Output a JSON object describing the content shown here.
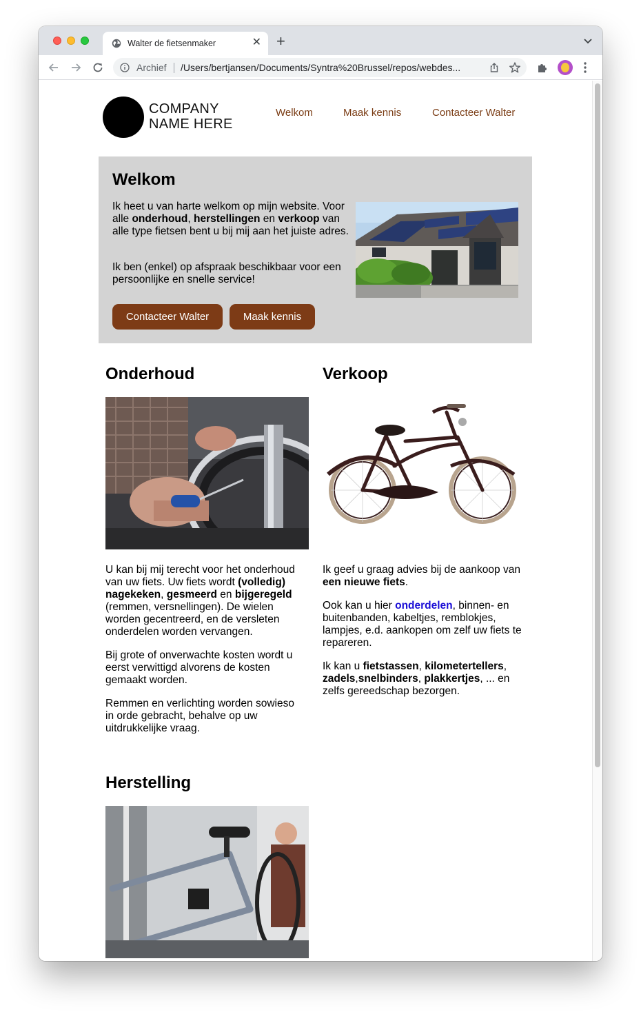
{
  "browser": {
    "tab_title": "Walter de fietsenmaker",
    "omnibox_label": "Archief",
    "url": "/Users/bertjansen/Documents/Syntra%20Brussel/repos/webdes..."
  },
  "site": {
    "logo_line1": "COMPANY",
    "logo_line2": "NAME HERE",
    "nav": [
      "Welkom",
      "Maak kennis",
      "Contacteer Walter"
    ]
  },
  "hero": {
    "heading": "Welkom",
    "p1": {
      "a": "Ik heet u van harte welkom op mijn website. Voor alle ",
      "b1": "onderhoud",
      "c": ", ",
      "b2": "herstellingen",
      "d": " en ",
      "b3": "verkoop",
      "e": " van alle type fietsen bent u bij mij aan het juiste adres."
    },
    "p2": "Ik ben (enkel) op afspraak beschikbaar voor een persoonlijke en snelle service!",
    "button_contact": "Contacteer Walter",
    "button_meet": "Maak kennis"
  },
  "onderhoud": {
    "heading": "Onderhoud",
    "p1": {
      "a": "U kan bij mij terecht voor het onderhoud van uw fiets. Uw fiets wordt ",
      "b1": "(volledig) nagekeken",
      "c": ", ",
      "b2": "gesmeerd",
      "d": " en ",
      "b3": "bijgeregeld",
      "e": " (remmen, versnellingen). De wielen worden gecentreerd, en de versleten onderdelen worden vervangen."
    },
    "p2": "Bij grote of onverwachte kosten wordt u eerst verwittigd alvorens de kosten gemaakt worden.",
    "p3": "Remmen en verlichting worden sowieso in orde gebracht, behalve op uw uitdrukkelijke vraag."
  },
  "verkoop": {
    "heading": "Verkoop",
    "p1": {
      "a": "Ik geef u graag advies bij de aankoop van ",
      "b1": "een nieuwe fiets",
      "c": "."
    },
    "p2": {
      "a": "Ook kan u hier ",
      "link": "onderdelen",
      "b": ", binnen- en buitenbanden, kabeltjes, remblokjes, lampjes, e.d. aankopen om zelf uw fiets te repareren."
    },
    "p3": {
      "a": "Ik kan u ",
      "b1": "fietstassen",
      "c": ", ",
      "b2": "kilometertellers",
      "d": ", ",
      "b3": "zadels",
      "e": ",",
      "b4": "snelbinders",
      "f": ", ",
      "b5": "plakkertjes",
      "g": ", ... en zelfs gereedschap bezorgen."
    }
  },
  "herstelling": {
    "heading": "Herstelling"
  },
  "icons": {
    "tab": "globe-icon",
    "nav": [
      "back-icon",
      "forward-icon",
      "reload-icon"
    ],
    "omnibox": [
      "info-icon",
      "share-icon",
      "star-icon"
    ],
    "toolbar": [
      "extensions-icon",
      "profile-avatar",
      "kebab-menu-icon"
    ]
  },
  "colors": {
    "brand": "#7d3b16",
    "nav_link": "#7a3c14",
    "hero_bg": "#d3d3d3",
    "link": "#1a0dd6"
  }
}
